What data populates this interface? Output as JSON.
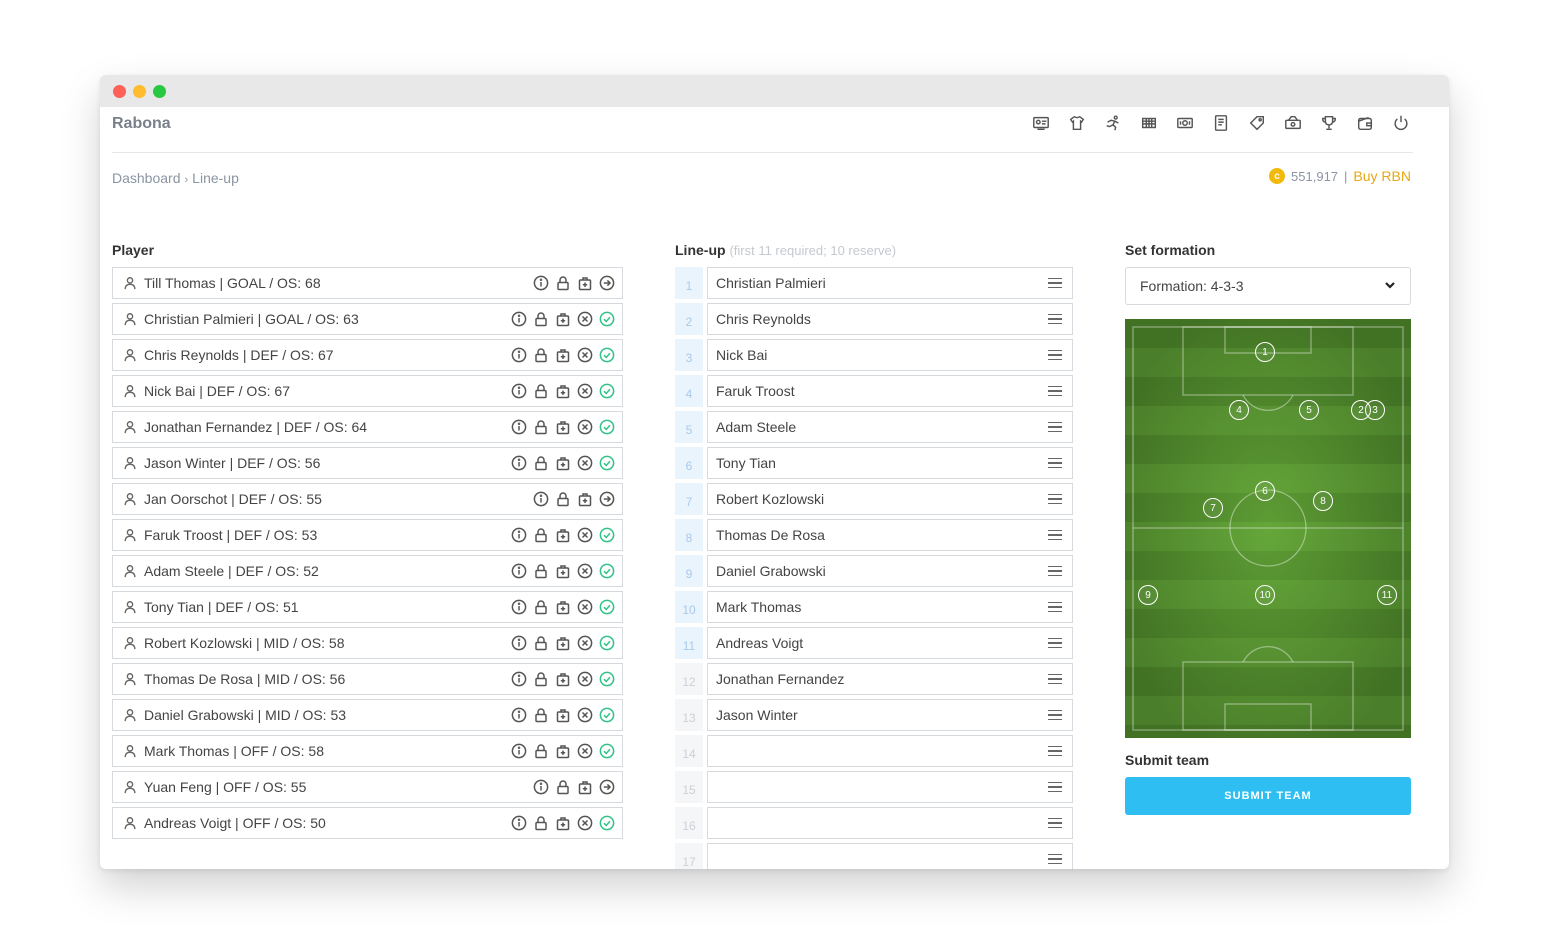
{
  "app": {
    "title": "Rabona"
  },
  "nav_icons": [
    "dashboard-icon",
    "jersey-icon",
    "training-icon",
    "stadium-icon",
    "money-icon",
    "report-icon",
    "tag-icon",
    "cash-icon",
    "trophy-icon",
    "wallet-icon",
    "power-icon"
  ],
  "breadcrumb": {
    "root": "Dashboard",
    "separator": "›",
    "current": "Line-up"
  },
  "balance": {
    "amount": "551,917",
    "separator": "|",
    "buy_label": "Buy RBN",
    "coin_symbol": "c"
  },
  "player_panel": {
    "title": "Player",
    "players": [
      {
        "label": "Till  Thomas | GOAL / OS: 68",
        "status": "available"
      },
      {
        "label": "Christian Palmieri | GOAL / OS: 63",
        "status": "selected"
      },
      {
        "label": "Chris Reynolds | DEF / OS: 67",
        "status": "selected"
      },
      {
        "label": "Nick Bai | DEF / OS: 67",
        "status": "selected"
      },
      {
        "label": "Jonathan Fernandez | DEF / OS: 64",
        "status": "selected"
      },
      {
        "label": "Jason Winter | DEF / OS: 56",
        "status": "selected"
      },
      {
        "label": "Jan Oorschot | DEF / OS: 55",
        "status": "available"
      },
      {
        "label": "Faruk Troost | DEF / OS: 53",
        "status": "selected"
      },
      {
        "label": "Adam Steele | DEF / OS: 52",
        "status": "selected"
      },
      {
        "label": "Tony Tian | DEF / OS: 51",
        "status": "selected"
      },
      {
        "label": "Robert Kozlowski | MID / OS: 58",
        "status": "selected"
      },
      {
        "label": "Thomas De Rosa | MID / OS: 56",
        "status": "selected"
      },
      {
        "label": "Daniel Grabowski | MID / OS: 53",
        "status": "selected"
      },
      {
        "label": "Mark Thomas | OFF / OS: 58",
        "status": "selected"
      },
      {
        "label": "Yuan Feng | OFF / OS: 55",
        "status": "available"
      },
      {
        "label": "Andreas Voigt | OFF / OS: 50",
        "status": "selected"
      }
    ]
  },
  "lineup_panel": {
    "title": "Line-up",
    "hint": "(first 11 required; 10 reserve)",
    "slots": [
      {
        "number": "1",
        "name": "Christian Palmieri"
      },
      {
        "number": "2",
        "name": "Chris Reynolds"
      },
      {
        "number": "3",
        "name": "Nick Bai"
      },
      {
        "number": "4",
        "name": "Faruk Troost"
      },
      {
        "number": "5",
        "name": "Adam Steele"
      },
      {
        "number": "6",
        "name": "Tony Tian"
      },
      {
        "number": "7",
        "name": "Robert Kozlowski"
      },
      {
        "number": "8",
        "name": "Thomas De Rosa"
      },
      {
        "number": "9",
        "name": "Daniel Grabowski"
      },
      {
        "number": "10",
        "name": "Mark Thomas"
      },
      {
        "number": "11",
        "name": "Andreas Voigt"
      },
      {
        "number": "12",
        "name": "Jonathan Fernandez"
      },
      {
        "number": "13",
        "name": "Jason Winter"
      },
      {
        "number": "14",
        "name": ""
      },
      {
        "number": "15",
        "name": ""
      },
      {
        "number": "16",
        "name": ""
      },
      {
        "number": "17",
        "name": ""
      }
    ]
  },
  "formation_panel": {
    "title": "Set formation",
    "selected": "Formation: 4-3-3",
    "positions": [
      "1",
      "2",
      "4",
      "5",
      "3",
      "6",
      "7",
      "8",
      "9",
      "10",
      "11"
    ]
  },
  "submit_panel": {
    "title": "Submit team",
    "button_label": "SUBMIT TEAM"
  },
  "colors": {
    "accent": "#2fbef2",
    "success": "#35c28a",
    "coin": "#f0b90b",
    "buy_link": "#e6a817",
    "pitch": "#4f8a2b"
  }
}
